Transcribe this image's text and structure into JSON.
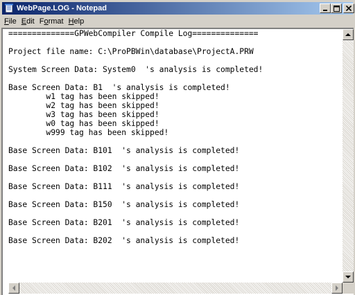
{
  "window": {
    "title": "WebPage.LOG - Notepad",
    "minimize_symbol": "_",
    "maximize_symbol": "□",
    "close_symbol": "×",
    "icon": "notepad-icon"
  },
  "menu": {
    "items": [
      {
        "label": "File",
        "accel": "F",
        "rest": "ile"
      },
      {
        "label": "Edit",
        "accel": "E",
        "rest": "dit"
      },
      {
        "label": "Format",
        "pre": "F",
        "accel": "o",
        "rest": "rmat"
      },
      {
        "label": "Help",
        "accel": "H",
        "rest": "elp"
      }
    ]
  },
  "document": {
    "lines": [
      "==============GPWebCompiler Compile Log==============",
      "Project file name: C:\\ProPBWin\\database\\ProjectA.PRW",
      "System Screen Data: System0  's analysis is completed!",
      "Base Screen Data: B1  's analysis is completed!",
      "        w1 tag has been skipped!",
      "        w2 tag has been skipped!",
      "        w3 tag has been skipped!",
      "        w0 tag has been skipped!",
      "        w999 tag has been skipped!",
      "Base Screen Data: B101  's analysis is completed!",
      "Base Screen Data: B102  's analysis is completed!",
      "Base Screen Data: B111  's analysis is completed!",
      "Base Screen Data: B150  's analysis is completed!",
      "Base Screen Data: B201  's analysis is completed!",
      "Base Screen Data: B202  's analysis is completed!"
    ]
  },
  "colors": {
    "titlebar_start": "#0a246a",
    "titlebar_end": "#a6caf0",
    "chrome": "#d4d0c8"
  }
}
